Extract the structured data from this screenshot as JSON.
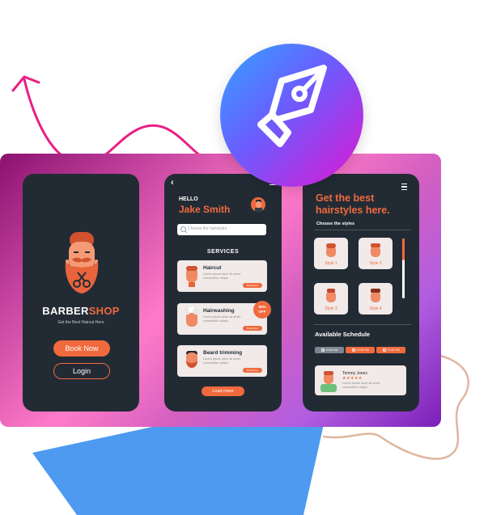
{
  "colors": {
    "accent": "#f06a3e",
    "phone_bg": "#222b34",
    "card_bg": "#f1eae9"
  },
  "icons": {
    "hero": "pen-nib-icon"
  },
  "splash": {
    "brand_part1": "BARBER",
    "brand_part2": "SHOP",
    "tagline": "Get the Best Haircut Here",
    "book_now": "Book Now",
    "login": "Login"
  },
  "home": {
    "back_glyph": "‹",
    "greeting": "HELLO",
    "user_name": "Jake Smith",
    "search_placeholder": "Choose the hairstyles",
    "services_title": "SERVICES",
    "services": [
      {
        "title": "Haircut",
        "desc": "Lorem ipsum dolor sit amet, consectetur adipis.",
        "button": "Book Now"
      },
      {
        "title": "Hairwashing",
        "desc": "Lorem ipsum dolor sit amet, consectetur adipis.",
        "button": "Book Now"
      },
      {
        "title": "Beard trimming",
        "desc": "Lorem ipsum dolor sit amet, consectetur adipis.",
        "button": "Book Now"
      }
    ],
    "discount": {
      "line1": "50%",
      "line2": "OFF"
    },
    "load_more": "Load more"
  },
  "styles": {
    "heading": "Get the best hairstyles here.",
    "choose_label": "Choose the styles",
    "style_labels": [
      "Style 1",
      "Style 2",
      "Style 3",
      "Style 4"
    ],
    "slider_fraction": 0.36,
    "schedule_title": "Available Schedule",
    "time_slots": [
      "10:00 AM",
      "07:30 PM",
      "07:00 PM"
    ],
    "review": {
      "name": "Tommy Jones",
      "stars": "★★★★★",
      "text": "Lorem ipsum dolor sit amet, consectetur adipis."
    }
  }
}
